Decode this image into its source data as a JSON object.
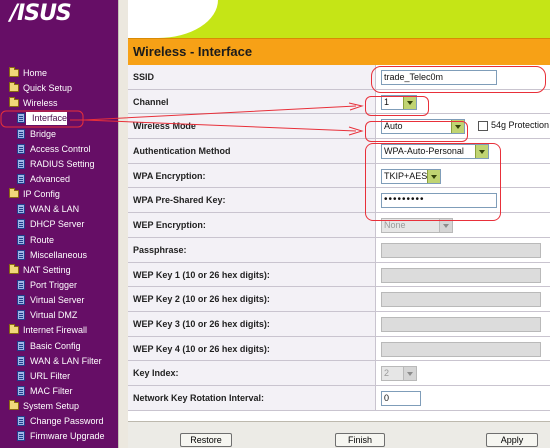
{
  "logo": {
    "text": "/ISUS"
  },
  "sidebar": {
    "items": [
      {
        "label": "Home",
        "level": "top",
        "icon": "folder-icon"
      },
      {
        "label": "Quick Setup",
        "level": "top",
        "icon": "folder-icon"
      },
      {
        "label": "Wireless",
        "level": "top",
        "icon": "folder-icon"
      },
      {
        "label": "Interface",
        "level": "sub",
        "icon": "doc-icon",
        "selected": true
      },
      {
        "label": "Bridge",
        "level": "sub",
        "icon": "doc-icon"
      },
      {
        "label": "Access Control",
        "level": "sub",
        "icon": "doc-icon"
      },
      {
        "label": "RADIUS Setting",
        "level": "sub",
        "icon": "doc-icon"
      },
      {
        "label": "Advanced",
        "level": "sub",
        "icon": "doc-icon"
      },
      {
        "label": "IP Config",
        "level": "top",
        "icon": "folder-icon"
      },
      {
        "label": "WAN & LAN",
        "level": "sub",
        "icon": "doc-icon"
      },
      {
        "label": "DHCP Server",
        "level": "sub",
        "icon": "doc-icon"
      },
      {
        "label": "Route",
        "level": "sub",
        "icon": "doc-icon"
      },
      {
        "label": "Miscellaneous",
        "level": "sub",
        "icon": "doc-icon"
      },
      {
        "label": "NAT Setting",
        "level": "top",
        "icon": "folder-icon"
      },
      {
        "label": "Port Trigger",
        "level": "sub",
        "icon": "doc-icon"
      },
      {
        "label": "Virtual Server",
        "level": "sub",
        "icon": "doc-icon"
      },
      {
        "label": "Virtual DMZ",
        "level": "sub",
        "icon": "doc-icon"
      },
      {
        "label": "Internet Firewall",
        "level": "top",
        "icon": "folder-icon"
      },
      {
        "label": "Basic Config",
        "level": "sub",
        "icon": "doc-icon"
      },
      {
        "label": "WAN & LAN Filter",
        "level": "sub",
        "icon": "doc-icon"
      },
      {
        "label": "URL Filter",
        "level": "sub",
        "icon": "doc-icon"
      },
      {
        "label": "MAC Filter",
        "level": "sub",
        "icon": "doc-icon"
      },
      {
        "label": "System Setup",
        "level": "top",
        "icon": "folder-icon"
      },
      {
        "label": "Change Password",
        "level": "sub",
        "icon": "doc-icon"
      },
      {
        "label": "Firmware Upgrade",
        "level": "sub",
        "icon": "doc-icon"
      }
    ]
  },
  "page": {
    "title": "Wireless - Interface"
  },
  "form": {
    "ssid": {
      "label": "SSID",
      "value": "trade_Telec0m"
    },
    "channel": {
      "label": "Channel",
      "value": "1"
    },
    "wireless_mode": {
      "label": "Wireless Mode",
      "value": "Auto",
      "protection_label": "54g Protection"
    },
    "auth_method": {
      "label": "Authentication Method",
      "value": "WPA-Auto-Personal"
    },
    "wpa_encryption": {
      "label": "WPA Encryption:",
      "value": "TKIP+AES"
    },
    "wpa_psk": {
      "label": "WPA Pre-Shared Key:",
      "value": "•••••••••"
    },
    "wep_encryption": {
      "label": "WEP Encryption:",
      "value": "None"
    },
    "passphrase": {
      "label": "Passphrase:",
      "value": ""
    },
    "wep_key1": {
      "label": "WEP Key 1 (10 or 26 hex digits):",
      "value": ""
    },
    "wep_key2": {
      "label": "WEP Key 2 (10 or 26 hex digits):",
      "value": ""
    },
    "wep_key3": {
      "label": "WEP Key 3 (10 or 26 hex digits):",
      "value": ""
    },
    "wep_key4": {
      "label": "WEP Key 4 (10 or 26 hex digits):",
      "value": ""
    },
    "key_index": {
      "label": "Key Index:",
      "value": "2"
    },
    "key_rotation": {
      "label": "Network Key Rotation Interval:",
      "value": "0"
    }
  },
  "buttons": {
    "restore": "Restore",
    "finish": "Finish",
    "apply": "Apply"
  },
  "colors": {
    "sidebar_bg": "#660e66",
    "banner": "#c5e516",
    "header": "#f7a116",
    "annotation": "#e8303a"
  }
}
